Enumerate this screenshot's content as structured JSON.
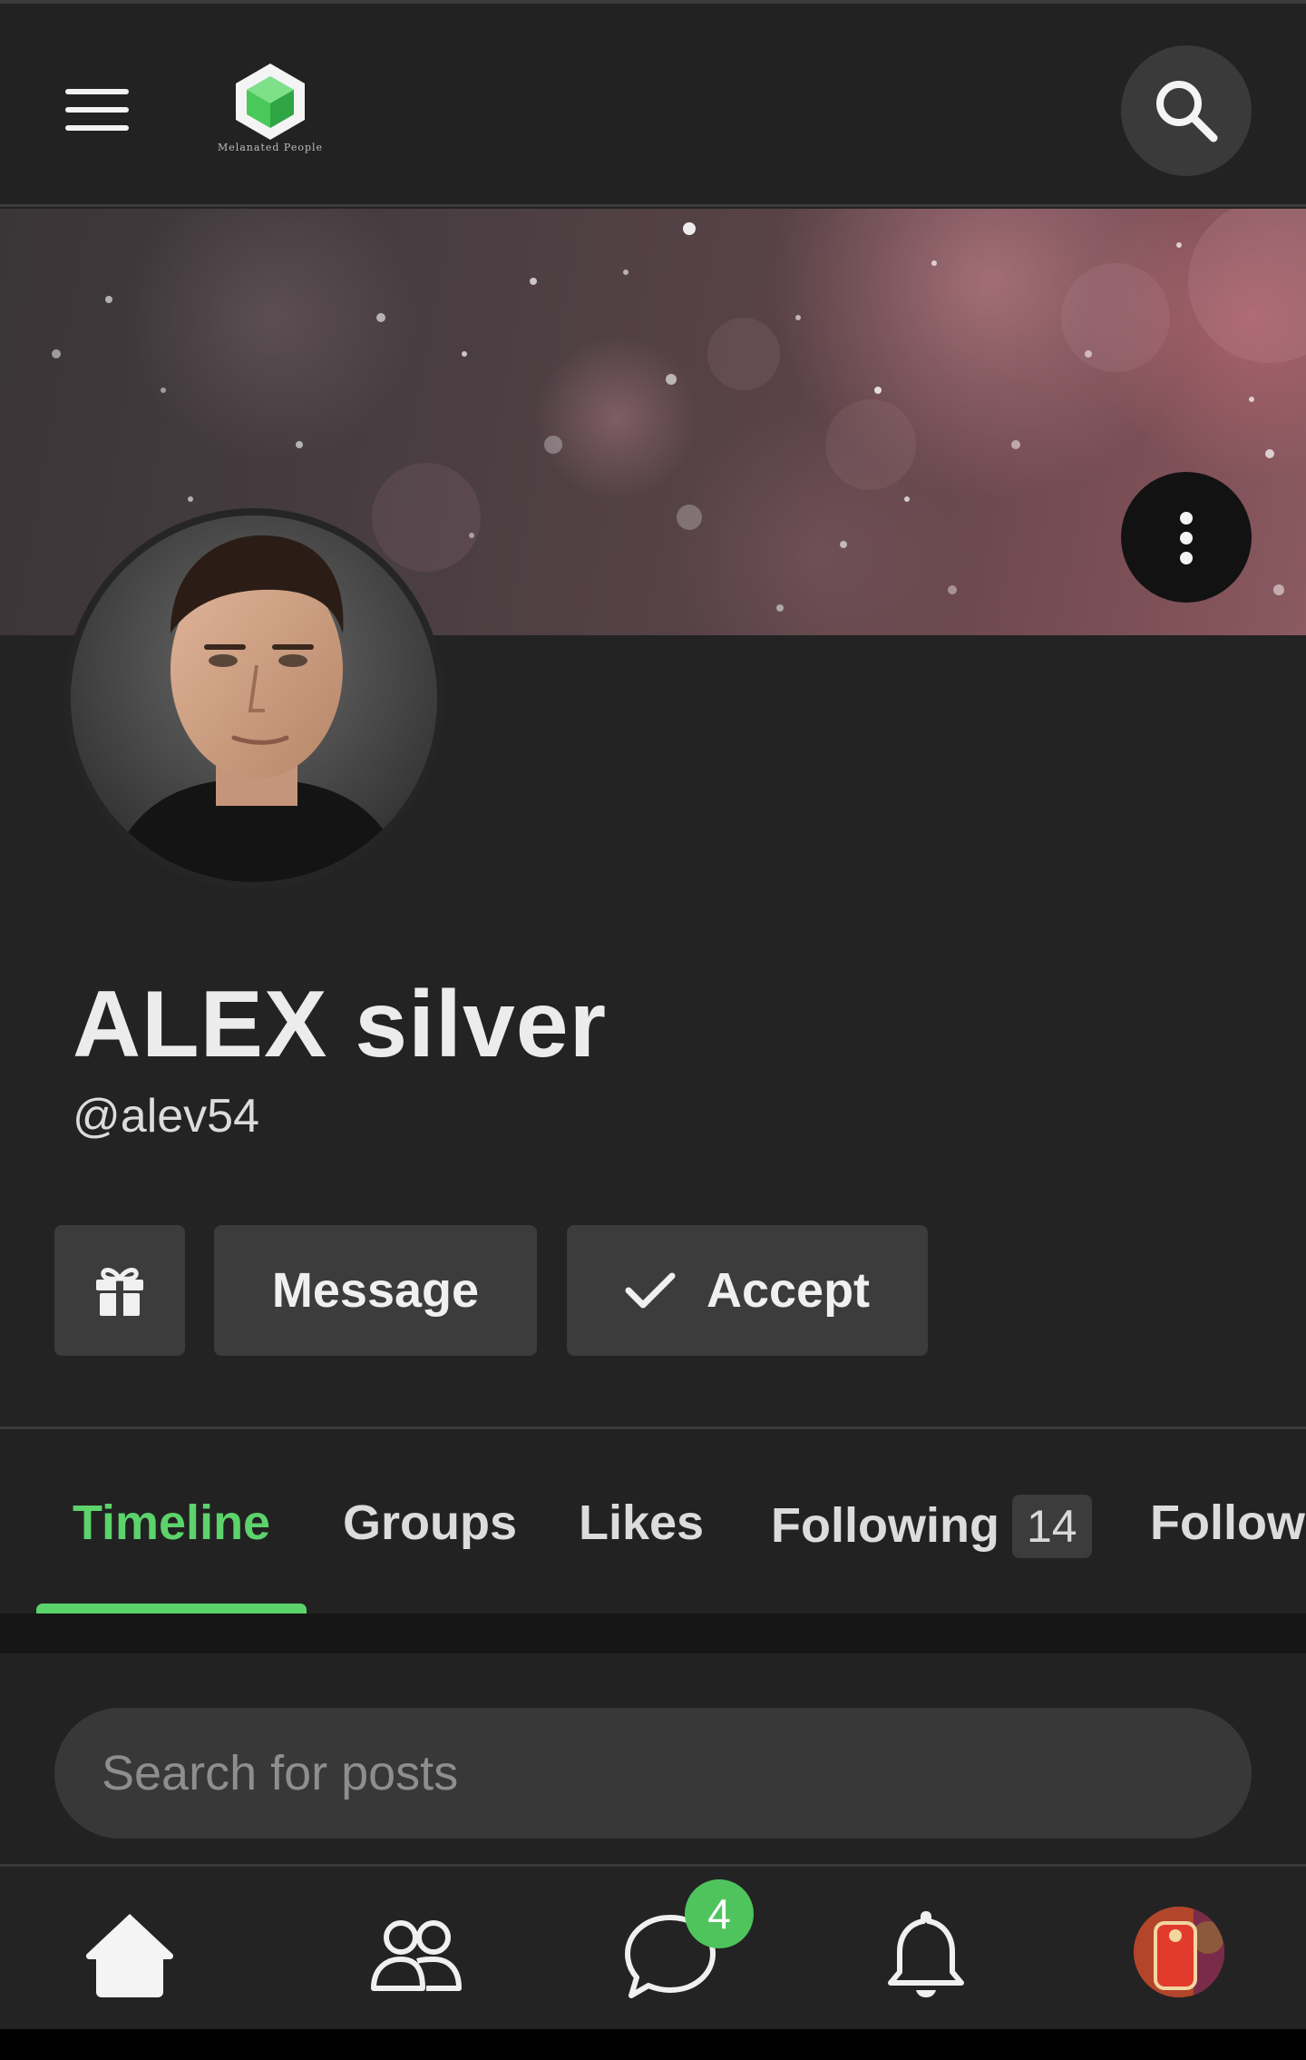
{
  "header": {
    "logo_text": "Melanated People",
    "icons": [
      "menu-icon",
      "logo-icon",
      "search-icon"
    ]
  },
  "cover": {
    "icons": [
      "more-vertical-icon"
    ]
  },
  "profile": {
    "name": "ALEX silver",
    "handle": "@alev54"
  },
  "actions": {
    "gift_icon": "gift-icon",
    "message_label": "Message",
    "accept_label": "Accept",
    "accept_icon": "check-icon"
  },
  "tabs": {
    "items": [
      {
        "label": "Timeline",
        "active": true
      },
      {
        "label": "Groups",
        "active": false
      },
      {
        "label": "Likes",
        "active": false
      },
      {
        "label": "Following",
        "count": "14",
        "active": false
      },
      {
        "label": "Followe",
        "active": false
      }
    ]
  },
  "search": {
    "placeholder": "Search for posts"
  },
  "bottom_nav": {
    "items": [
      "home-icon",
      "friends-icon",
      "messages-icon",
      "notifications-icon",
      "user-avatar"
    ],
    "messages_badge": "4"
  },
  "colors": {
    "accent": "#5cd36b",
    "badge": "#4fc45c",
    "background": "#232323",
    "button": "#3c3c3c"
  }
}
